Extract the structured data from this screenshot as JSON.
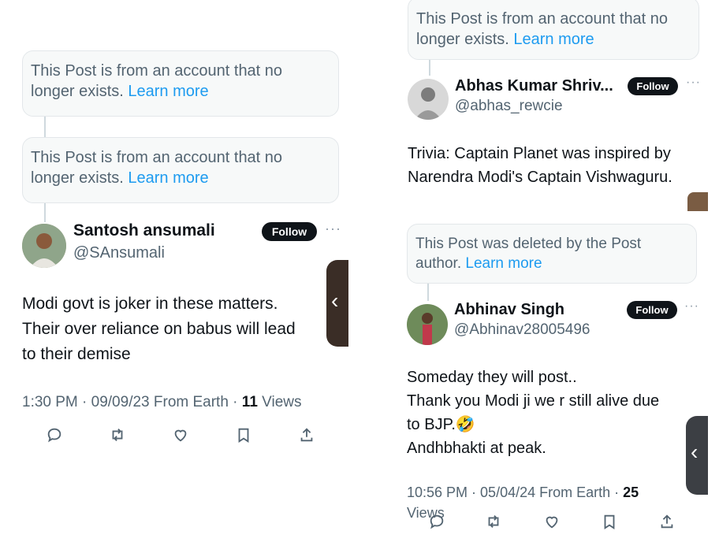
{
  "left_panel": {
    "notice1": {
      "text": "This Post is from an account that no longer exists.",
      "link": "Learn more"
    },
    "notice2": {
      "text": "This Post is from an account that no longer exists.",
      "link": "Learn more"
    },
    "post": {
      "name": "Santosh ansumali",
      "handle": "@SAnsumali",
      "follow_label": "Follow",
      "text_lines": [
        "Modi govt is joker in these matters.",
        "Their over reliance on babus will lead",
        "to their demise"
      ],
      "time": "1:30 PM · 09/09/23 From Earth ·",
      "views_count": "11",
      "views_label": "Views"
    }
  },
  "right_panel": {
    "notice_top": {
      "text": "This Post is from an account that no longer exists.",
      "link": "Learn more"
    },
    "post1": {
      "name": "Abhas Kumar Shriv...",
      "handle": "@abhas_rewcie",
      "follow_label": "Follow",
      "text_lines": [
        "Trivia: Captain Planet was inspired by",
        "Narendra Modi's Captain Vishwaguru."
      ]
    },
    "notice_deleted": {
      "text": "This Post was deleted by the Post author.",
      "link": "Learn more"
    },
    "post2": {
      "name": "Abhinav Singh",
      "handle": "@Abhinav28005496",
      "follow_label": "Follow",
      "text_lines": [
        "Someday they will post..",
        "Thank you Modi ji we r still alive due",
        "to BJP.🤣",
        "Andhbhakti at peak."
      ],
      "time": "10:56 PM · 05/04/24 From Earth ·",
      "views_count": "25",
      "views_label": "Views"
    }
  },
  "icons": [
    "reply-icon",
    "retweet-icon",
    "like-icon",
    "bookmark-icon",
    "share-icon",
    "chevron-left-icon",
    "more-icon"
  ]
}
